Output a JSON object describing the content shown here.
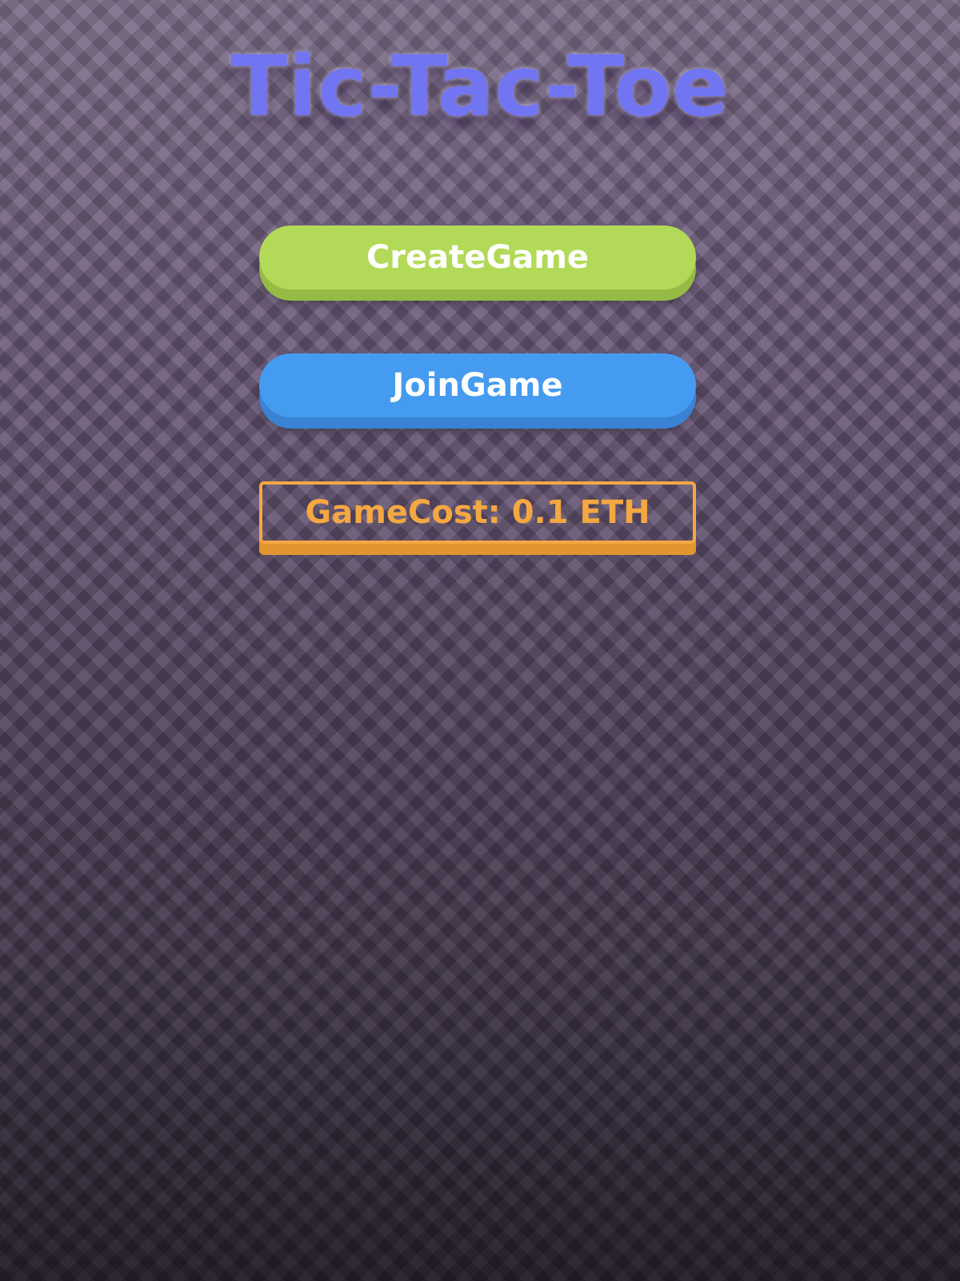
{
  "game": {
    "title": "Tic-Tac-Toe"
  },
  "menu": {
    "create_label": "CreateGame",
    "join_label": "JoinGame",
    "cost_label": "GameCost: 0.1 ETH"
  },
  "colors": {
    "title": "#7175f2",
    "create_button": "#b2da58",
    "join_button": "#459bf0",
    "cost_accent": "#f5a742"
  }
}
